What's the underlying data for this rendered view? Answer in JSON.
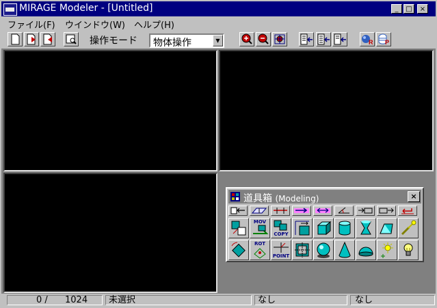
{
  "window": {
    "title": "MIRAGE Modeler - [Untitled]",
    "minimize": "_",
    "maximize": "□",
    "close": "×"
  },
  "menu": [
    {
      "label": "ファイル(F)"
    },
    {
      "label": "ウインドウ(W)"
    },
    {
      "label": "ヘルプ(H)"
    }
  ],
  "toolbar": {
    "mode_label": "操作モード",
    "mode_value": "物体操作",
    "mode_arrow": "▼",
    "icons": [
      "new-file-icon",
      "open-file-icon",
      "save-file-icon",
      "print-preview-icon",
      "zoom-in-icon",
      "zoom-out-icon",
      "zoom-fit-icon",
      "view-split-1-icon",
      "view-split-2-icon",
      "view-split-3-icon",
      "render-r-icon",
      "render-p-icon"
    ]
  },
  "toolbox": {
    "title": "道具箱",
    "subtitle": "(Modeling)",
    "close": "×",
    "small_tools": [
      "tool-1",
      "tool-2",
      "tool-3",
      "tool-4",
      "tool-5",
      "tool-6",
      "tool-7",
      "tool-8",
      "tool-9"
    ],
    "captions": {
      "move": "MOV",
      "copy": "COPY",
      "rot": "ROT",
      "point": "POINT"
    }
  },
  "status": {
    "count": "0 /",
    "max": "1024",
    "selection": "未選択",
    "field3": "なし",
    "field4": "なし"
  },
  "colors": {
    "titlebar": "#000080",
    "face": "#c0c0c0",
    "viewport": "#000000",
    "toolbox_title": "#808080"
  }
}
